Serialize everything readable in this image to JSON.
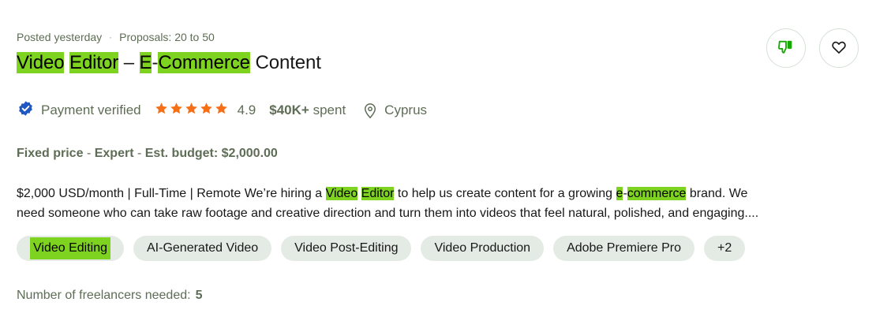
{
  "job": {
    "posted": "Posted yesterday",
    "separator": "·",
    "proposals": "Proposals: 20 to 50",
    "title_parts": [
      "Video",
      " ",
      "Editor",
      " – ",
      "E",
      "-",
      "Commerce",
      " Content"
    ],
    "client": {
      "payment_verified": "Payment verified",
      "rating": "4.9",
      "rating_stars": 5,
      "spent_amount": "$40K+",
      "spent_label": "spent",
      "location": "Cyprus"
    },
    "budget": {
      "type": "Fixed price",
      "level": "Expert",
      "est_label": "Est. budget:",
      "est_value": "$2,000.00"
    },
    "description": {
      "l1_a": "$2,000 USD/month | Full-Time | Remote We’re hiring a ",
      "l1_hl1": "Video",
      "l1_sp": " ",
      "l1_hl2": "Editor",
      "l1_b": " to help us create content for a growing ",
      "l1_hl3": "e",
      "l1_dash": "-",
      "l1_hl4": "commerce",
      "l1_c": " brand. We",
      "l2": "need someone who can take raw footage and creative direction and turn them into videos that feel natural, polished, and engaging...."
    },
    "skills": [
      "Video Editing",
      "AI-Generated Video",
      "Video Post-Editing",
      "Video Production",
      "Adobe Premiere Pro",
      "+2"
    ],
    "freelancers_label": "Number of freelancers needed:",
    "freelancers_count": "5"
  },
  "colors": {
    "highlight": "#7ed321",
    "verified": "#1f57c3",
    "star": "#f66e16",
    "thumb_down": "#14a800",
    "tag_bg": "#e4ebe4"
  },
  "icons": {
    "verified": "verified-badge-icon",
    "star": "star-icon",
    "location": "location-pin-icon",
    "thumb_down": "thumbs-down-icon",
    "heart": "heart-icon"
  }
}
